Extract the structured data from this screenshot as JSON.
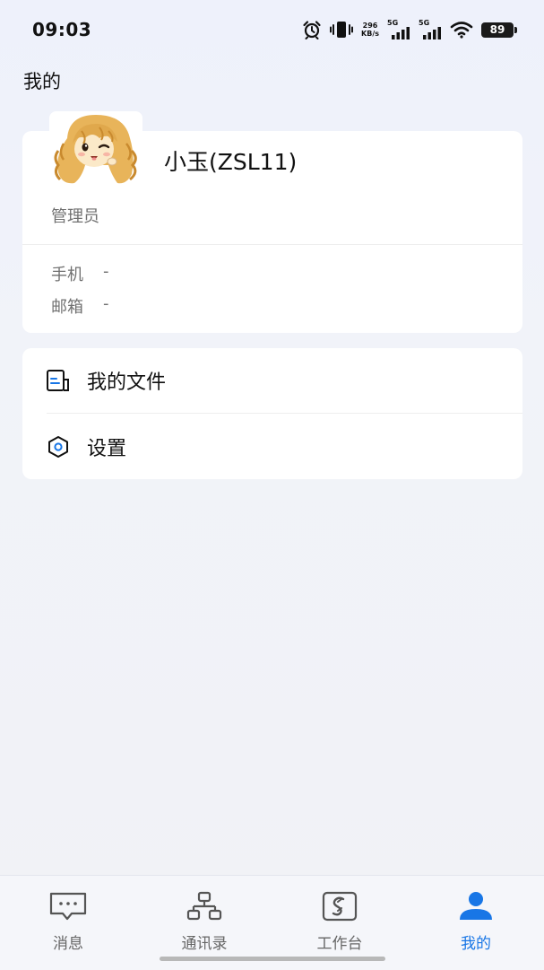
{
  "status_bar": {
    "time": "09:03",
    "net_speed_value": "296",
    "net_speed_unit": "KB/s",
    "signal1_label": "5G",
    "signal2_label": "5G",
    "battery": "89",
    "icons": [
      "alarm-icon",
      "vibrate-icon",
      "signal-icon",
      "wifi-icon",
      "battery-icon"
    ]
  },
  "page": {
    "title": "我的"
  },
  "profile": {
    "name": "小玉(ZSL11)",
    "role": "管理员",
    "phone_label": "手机",
    "phone_value": "-",
    "email_label": "邮箱",
    "email_value": "-"
  },
  "menu": {
    "items": [
      {
        "label": "我的文件",
        "icon": "file-icon"
      },
      {
        "label": "设置",
        "icon": "settings-icon"
      }
    ]
  },
  "tabbar": {
    "active_color": "#1876e6",
    "tabs": [
      {
        "label": "消息",
        "icon": "message-icon"
      },
      {
        "label": "通讯录",
        "icon": "contacts-icon"
      },
      {
        "label": "工作台",
        "icon": "workbench-icon"
      },
      {
        "label": "我的",
        "icon": "user-icon",
        "active": true
      }
    ]
  }
}
